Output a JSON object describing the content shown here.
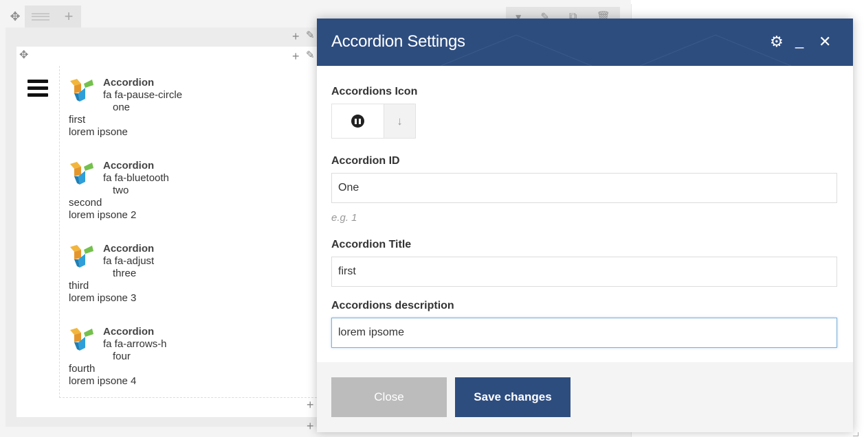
{
  "builder": {
    "row_toolbar_left": {
      "move_icon": "arrows-move-icon",
      "layout_icon": "row-layout-icon",
      "add_icon": "plus-icon"
    },
    "row_toolbar_right": [
      "chevron-down-icon",
      "pencil-icon",
      "copy-icon",
      "trash-icon"
    ],
    "accordions": [
      {
        "name": "Accordion",
        "icon": "fa fa-pause-circle",
        "id": "one",
        "title": "first",
        "description": "lorem ipsone"
      },
      {
        "name": "Accordion",
        "icon": "fa fa-bluetooth",
        "id": "two",
        "title": "second",
        "description": "lorem ipsone 2"
      },
      {
        "name": "Accordion",
        "icon": "fa fa-adjust",
        "id": "three",
        "title": "third",
        "description": "lorem ipsone 3"
      },
      {
        "name": "Accordion",
        "icon": "fa fa-arrows-h",
        "id": "four",
        "title": "fourth",
        "description": "lorem ipsone 4"
      }
    ]
  },
  "modal": {
    "title": "Accordion Settings",
    "header_controls": [
      "gear-icon",
      "minimize-icon",
      "close-icon"
    ],
    "fields": {
      "icon": {
        "label": "Accordions Icon",
        "selected": "fa fa-pause-circle"
      },
      "id": {
        "label": "Accordion ID",
        "value": "One",
        "hint": "e.g. 1"
      },
      "title": {
        "label": "Accordion Title",
        "value": "first"
      },
      "description": {
        "label": "Accordions description",
        "value": "lorem ipsome"
      }
    },
    "buttons": {
      "close": "Close",
      "save": "Save changes"
    }
  },
  "colors": {
    "header": "#2e4d7f",
    "save_button": "#2e4d7f",
    "close_button": "#bcbcbc",
    "input_focus": "#7fb2d8"
  }
}
